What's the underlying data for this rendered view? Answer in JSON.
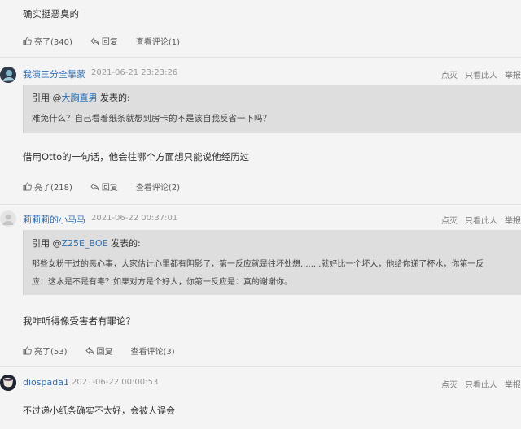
{
  "comments": [
    {
      "body": "确实挺恶臭的",
      "actions": {
        "like": "亮了(340)",
        "reply": "回复",
        "view": "查看评论(1)"
      }
    },
    {
      "username": "我演三分全靠蒙",
      "time": "2021-06-21 23:23:26",
      "right": {
        "a": "点灭",
        "b": "只看此人",
        "c": "举报"
      },
      "quote": {
        "prefix": "引用 @",
        "user": "大胸直男",
        "suffix": " 发表的:",
        "lines": [
          "难免什么？自己看着纸条就想到房卡的不是该自我反省一下吗？"
        ]
      },
      "body": "借用Otto的一句话，他会往哪个方面想只能说他经历过",
      "actions": {
        "like": "亮了(218)",
        "reply": "回复",
        "view": "查看评论(2)"
      }
    },
    {
      "username": "莉莉莉的小马马",
      "time": "2021-06-22 00:37:01",
      "right": {
        "a": "点灭",
        "b": "只看此人",
        "c": "举报"
      },
      "quote": {
        "prefix": "引用 @",
        "user": "Z25E_BOE",
        "suffix": " 发表的:",
        "lines": [
          "那些女粉干过的恶心事，大家估计心里都有阴影了，第一反应就是往坏处想........就好比一个坏人，他给你递了杯水，你第一反",
          "应：这水是不是有毒？如果对方是个好人，你第一反应是：真的谢谢你。"
        ]
      },
      "body": "我咋听得像受害者有罪论？",
      "actions": {
        "like": "亮了(53)",
        "reply": "回复",
        "view": "查看评论(3)"
      }
    },
    {
      "username": "diospada1",
      "time": "2021-06-22 00:00:53",
      "right": {
        "a": "点灭",
        "b": "只看此人",
        "c": "举报"
      },
      "body": "不过递小纸条确实不太好，会被人误会"
    }
  ]
}
